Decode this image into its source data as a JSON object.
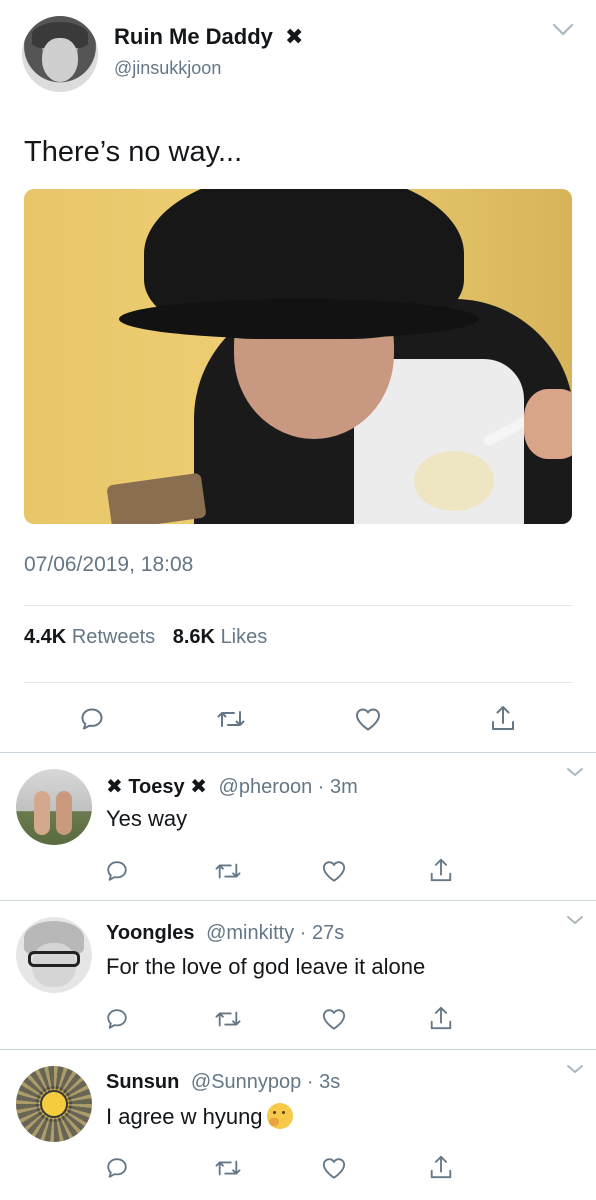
{
  "main_tweet": {
    "author_name": "Ruin Me Daddy",
    "author_badge": "✖",
    "author_handle": "@jinsukkjoon",
    "text": "There’s no way...",
    "timestamp": "07/06/2019, 18:08",
    "retweets_count": "4.4K",
    "retweets_label": "Retweets",
    "likes_count": "8.6K",
    "likes_label": "Likes",
    "actions": [
      "reply-icon",
      "retweet-icon",
      "like-icon",
      "share-icon"
    ]
  },
  "replies": [
    {
      "name": "✖ Toesy ✖",
      "handle": "@pheroon",
      "time": "3m",
      "text": "Yes way"
    },
    {
      "name": "Yoongles",
      "handle": "@minkitty",
      "time": "27s",
      "text": "For the love of god leave it alone"
    },
    {
      "name": "Sunsun",
      "handle": "@Sunnypop",
      "time": "3s",
      "text": "I agree w hyung",
      "emoji": "thinking-face"
    }
  ],
  "separator": "·",
  "colors": {
    "text": "#14171a",
    "secondary": "#657786",
    "icon": "#657786",
    "divider": "#e1e8ed"
  }
}
